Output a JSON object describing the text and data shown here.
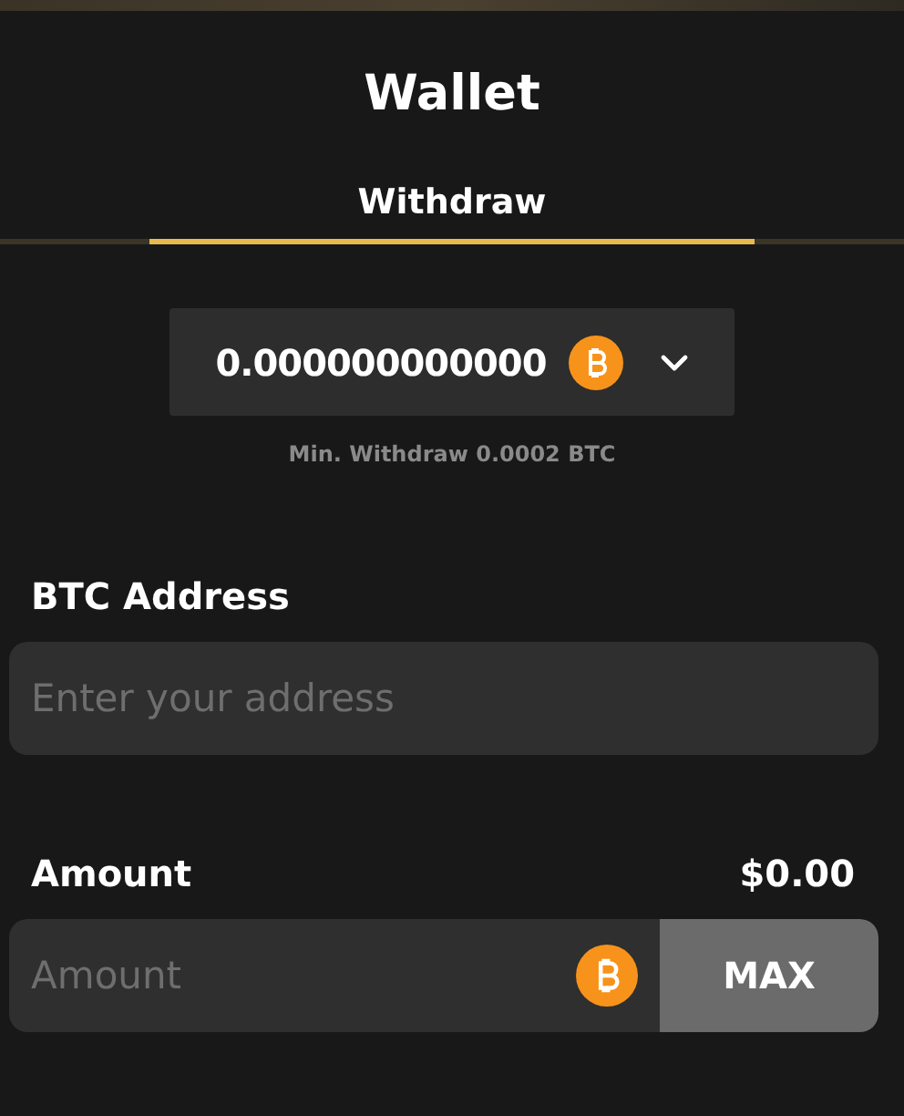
{
  "title": "Wallet",
  "tabs": [
    {
      "label": "Withdraw",
      "selected": true
    }
  ],
  "currency_select": {
    "value": "0.000000000000"
  },
  "min_note": "Min. Withdraw 0.0002 BTC",
  "address": {
    "label": "BTC Address",
    "placeholder": "Enter your address"
  },
  "amount": {
    "label": "Amount",
    "usd_value": "$0.00",
    "placeholder": "Amount",
    "max_button": "MAX"
  }
}
